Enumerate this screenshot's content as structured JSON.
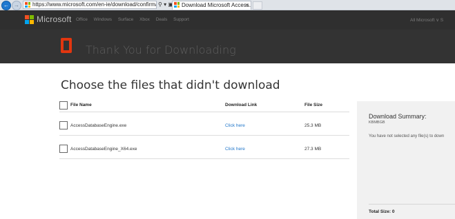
{
  "browser": {
    "url": "https://www.microsoft.com/en-ie/download/confirmation.",
    "tab_title": "Download Microsoft Access...",
    "tab_close": "×"
  },
  "header": {
    "brand": "Microsoft",
    "nav_items": [
      "Office",
      "Windows",
      "Surface",
      "Xbox",
      "Deals",
      "Support"
    ],
    "nav_right": "All Microsoft ∨  S"
  },
  "banner": {
    "title": "Thank You for Downloading"
  },
  "main": {
    "title": "Choose the files that didn't download",
    "columns": {
      "name": "File Name",
      "link": "Download Link",
      "size": "File Size"
    },
    "files": [
      {
        "name": "AccessDatabaseEngine.exe",
        "link": "Click here",
        "size": "25.3 MB"
      },
      {
        "name": "AccessDatabaseEngine_X64.exe",
        "link": "Click here",
        "size": "27.3 MB"
      }
    ]
  },
  "summary": {
    "title": "Download Summary:",
    "size_label": "KBMBGB",
    "message": "You have not selected any file(s) to down",
    "total": "Total Size: 0"
  },
  "colors": {
    "header_bg": "#2f2f2f",
    "banner_bg": "#333333",
    "office_red": "#e2360f",
    "link_blue": "#1f75c9",
    "summary_bg": "#f1f1f1"
  }
}
